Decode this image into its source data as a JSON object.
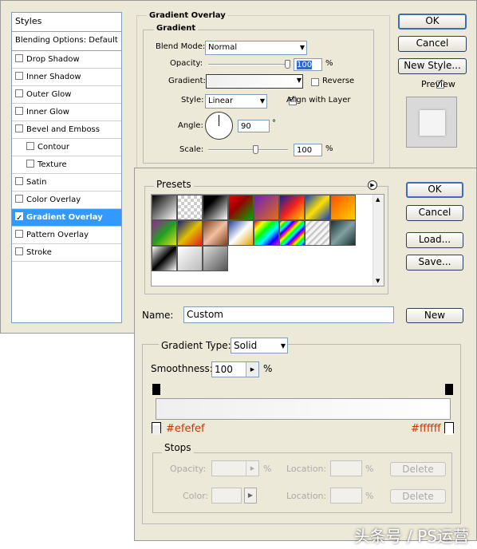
{
  "layer_style": {
    "styles_header": "Styles",
    "blending_options": "Blending Options: Default",
    "items": [
      {
        "label": "Drop Shadow",
        "checked": false,
        "sub": false,
        "selected": false
      },
      {
        "label": "Inner Shadow",
        "checked": false,
        "sub": false,
        "selected": false
      },
      {
        "label": "Outer Glow",
        "checked": false,
        "sub": false,
        "selected": false
      },
      {
        "label": "Inner Glow",
        "checked": false,
        "sub": false,
        "selected": false
      },
      {
        "label": "Bevel and Emboss",
        "checked": false,
        "sub": false,
        "selected": false
      },
      {
        "label": "Contour",
        "checked": false,
        "sub": true,
        "selected": false
      },
      {
        "label": "Texture",
        "checked": false,
        "sub": true,
        "selected": false
      },
      {
        "label": "Satin",
        "checked": false,
        "sub": false,
        "selected": false
      },
      {
        "label": "Color Overlay",
        "checked": false,
        "sub": false,
        "selected": false
      },
      {
        "label": "Gradient Overlay",
        "checked": true,
        "sub": false,
        "selected": true
      },
      {
        "label": "Pattern Overlay",
        "checked": false,
        "sub": false,
        "selected": false
      },
      {
        "label": "Stroke",
        "checked": false,
        "sub": false,
        "selected": false
      }
    ],
    "section_title": "Gradient Overlay",
    "group_title": "Gradient",
    "blend_mode_label": "Blend Mode:",
    "blend_mode_value": "Normal",
    "opacity_label": "Opacity:",
    "opacity_value": "100",
    "opacity_percent": 100,
    "percent": "%",
    "gradient_label": "Gradient:",
    "reverse_label": "Reverse",
    "reverse_checked": false,
    "style_label": "Style:",
    "style_value": "Linear",
    "align_label": "Align with Layer",
    "align_checked": true,
    "angle_label": "Angle:",
    "angle_value": "90",
    "degree": "°",
    "scale_label": "Scale:",
    "scale_value": "100",
    "scale_percent": 100,
    "ok": "OK",
    "cancel": "Cancel",
    "new_style": "New Style...",
    "preview_label": "Preview",
    "preview_checked": true
  },
  "gradient_editor": {
    "presets_label": "Presets",
    "ok": "OK",
    "cancel": "Cancel",
    "load": "Load...",
    "save": "Save...",
    "name_label": "Name:",
    "name_value": "Custom",
    "new_button": "New",
    "gradient_type_label": "Gradient Type:",
    "gradient_type_value": "Solid",
    "smoothness_label": "Smoothness:",
    "smoothness_value": "100",
    "percent": "%",
    "left_stop_color": "#efefef",
    "right_stop_color": "#ffffff",
    "left_stop_label": "#efefef",
    "right_stop_label": "#ffffff",
    "stops_label": "Stops",
    "opacity_label": "Opacity:",
    "location_label": "Location:",
    "color_label": "Color:",
    "delete_label": "Delete"
  },
  "presets": [
    "linear-gradient(135deg,#000,#fff)",
    "repeating-conic-gradient(#ccc 0 25%,#fff 0 50%) 0 0/8px 8px",
    "linear-gradient(135deg,#000 30%,#fff)",
    "linear-gradient(135deg,#e00,#900 40%,#0a0)",
    "linear-gradient(135deg,#7020c0,#e07010)",
    "linear-gradient(135deg,#1020a0,#f02020,#ffd000)",
    "linear-gradient(135deg,#1040c0,#ffe000,#1040c0)",
    "linear-gradient(135deg,#ff5000,#ffd000)",
    "linear-gradient(135deg,#a020a0,#20a020,#e0e020)",
    "linear-gradient(135deg,#102080,#e0c000,#e02020)",
    "linear-gradient(135deg,#804020,#f0c0a0,#804020)",
    "linear-gradient(135deg,#2040a0,#fff,#e0a000)",
    "linear-gradient(135deg,#f00,#ff0,#0f0,#0ff,#00f,#f0f)",
    "repeating-linear-gradient(135deg,#f00 0,#ff0 3px,#0f0 6px,#0ff 9px,#00f 12px,#f0f 15px)",
    "repeating-linear-gradient(135deg,#ddd 0,#fff 3px,#aaa 6px)",
    "linear-gradient(135deg,#1a3030,#80a0a0,#1a3030)",
    "linear-gradient(135deg,#fff,#000 50%,#fff)",
    "linear-gradient(135deg,#fff,#bbb)",
    "linear-gradient(135deg,#ddd,#555)"
  ],
  "watermark": "头条号 / PS运营"
}
